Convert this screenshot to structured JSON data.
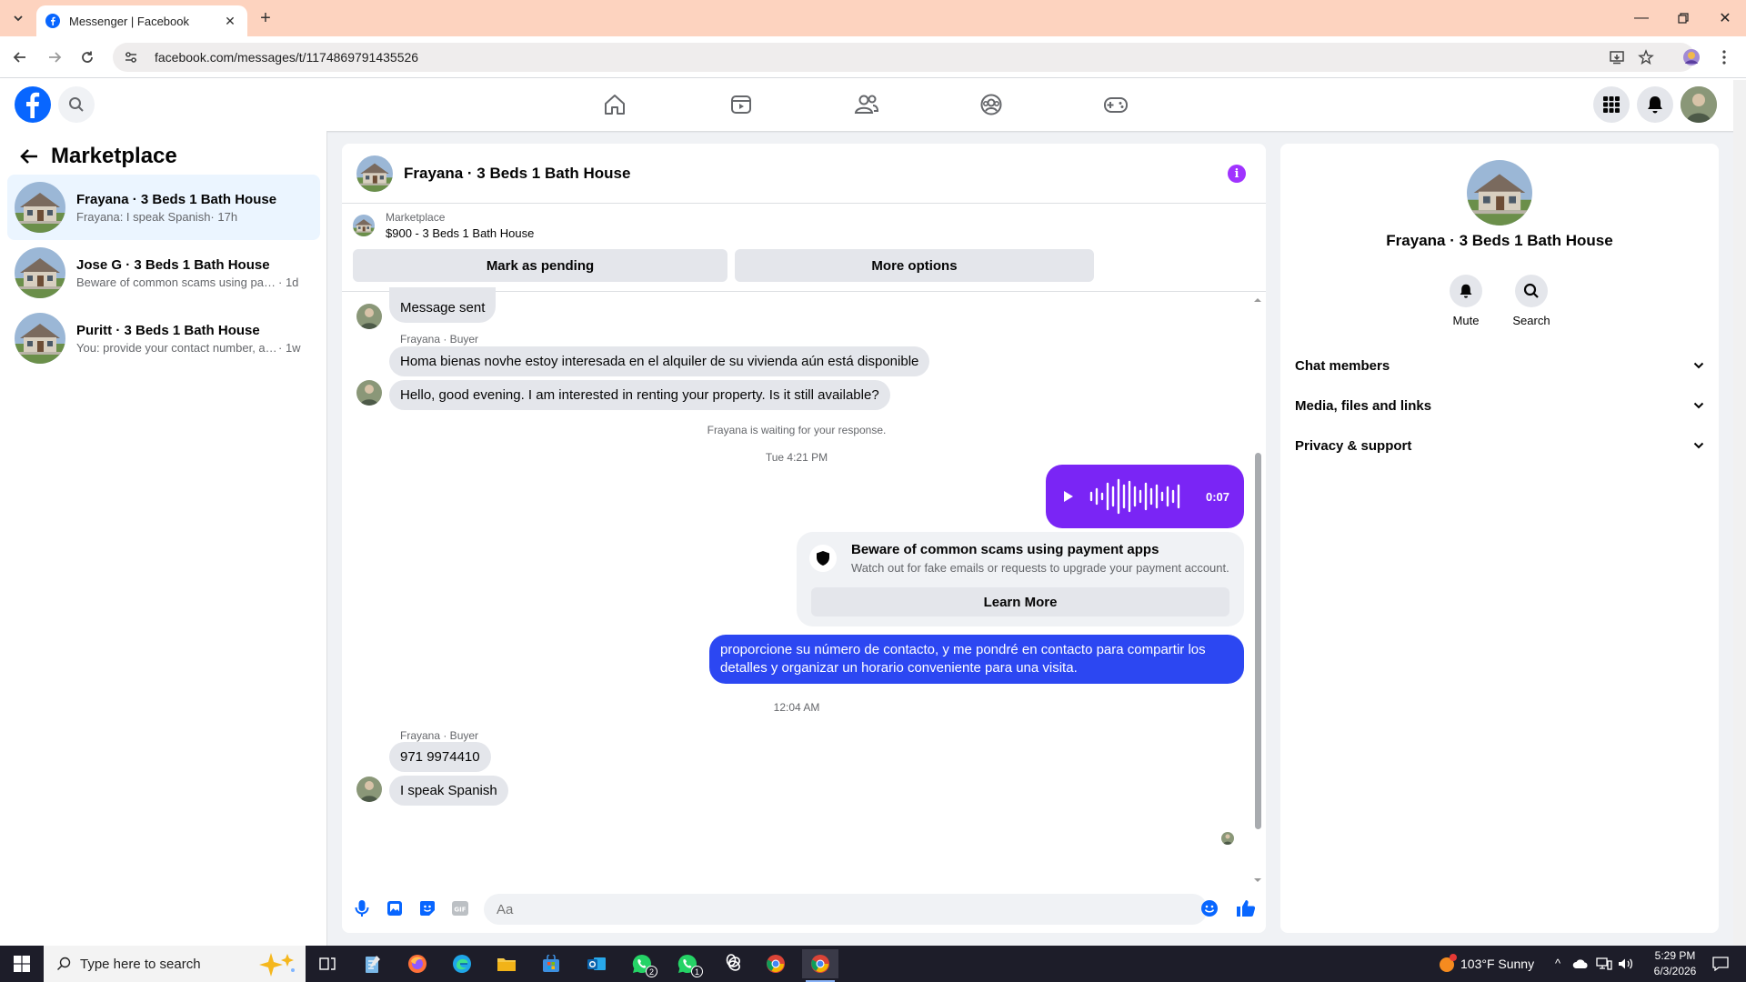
{
  "browser": {
    "tab_title": "Messenger | Facebook",
    "url": "facebook.com/messages/t/1174869791435526"
  },
  "left": {
    "title": "Marketplace",
    "conversations": [
      {
        "name": "Frayana · 3 Beds 1 Bath House",
        "preview": "Frayana: I speak Spanish",
        "time": " · 17h"
      },
      {
        "name": "Jose G · 3 Beds 1 Bath House",
        "preview": "Beware of common scams using pay...",
        "time": " · 1d"
      },
      {
        "name": "Puritt · 3 Beds 1 Bath House",
        "preview": "You: provide your contact number, an...",
        "time": " · 1w"
      }
    ]
  },
  "chat": {
    "title": "Frayana · 3 Beds 1 Bath House",
    "marketplace_label": "Marketplace",
    "listing": "$900 - 3 Beds 1 Bath House",
    "mark_pending": "Mark as pending",
    "more_options": "More options",
    "messages": {
      "sent_notice": "Message sent",
      "sender1": "Frayana · Buyer",
      "m1": "Homa bienas novhe estoy interesada en el alquiler de su vivienda aún está disponible",
      "m2": "Hello, good evening. I am interested in renting your property. Is it still available?",
      "waiting": "Frayana is waiting for your response.",
      "ts1": "Tue 4:21 PM",
      "voice_duration": "0:07",
      "scam_title": "Beware of common scams using payment apps",
      "scam_desc": "Watch out for fake emails or requests to upgrade your payment account.",
      "learn_more": "Learn More",
      "outgoing": "proporcione su número de contacto, y me pondré en contacto para compartir los detalles y organizar un horario conveniente para una visita.",
      "ts2": "12:04 AM",
      "sender2": "Frayana · Buyer",
      "m3": "971 9974410",
      "m4": "I speak Spanish"
    },
    "composer_placeholder": "Aa"
  },
  "right": {
    "name": "Frayana · 3 Beds 1 Bath House",
    "mute": "Mute",
    "search": "Search",
    "sections": [
      "Chat members",
      "Media, files and links",
      "Privacy & support"
    ]
  },
  "taskbar": {
    "search_placeholder": "Type here to search",
    "weather": "103°F  Sunny",
    "time": "5:29 PM",
    "date": "6/3/2026",
    "whatsapp_badge_1": "2",
    "whatsapp_badge_2": "1"
  },
  "colors": {
    "fb_blue": "#0866ff",
    "outgoing_bubble": "#2c47f2",
    "voice_bubble": "#7a25f5",
    "tabbar": "#fdd3bf"
  }
}
